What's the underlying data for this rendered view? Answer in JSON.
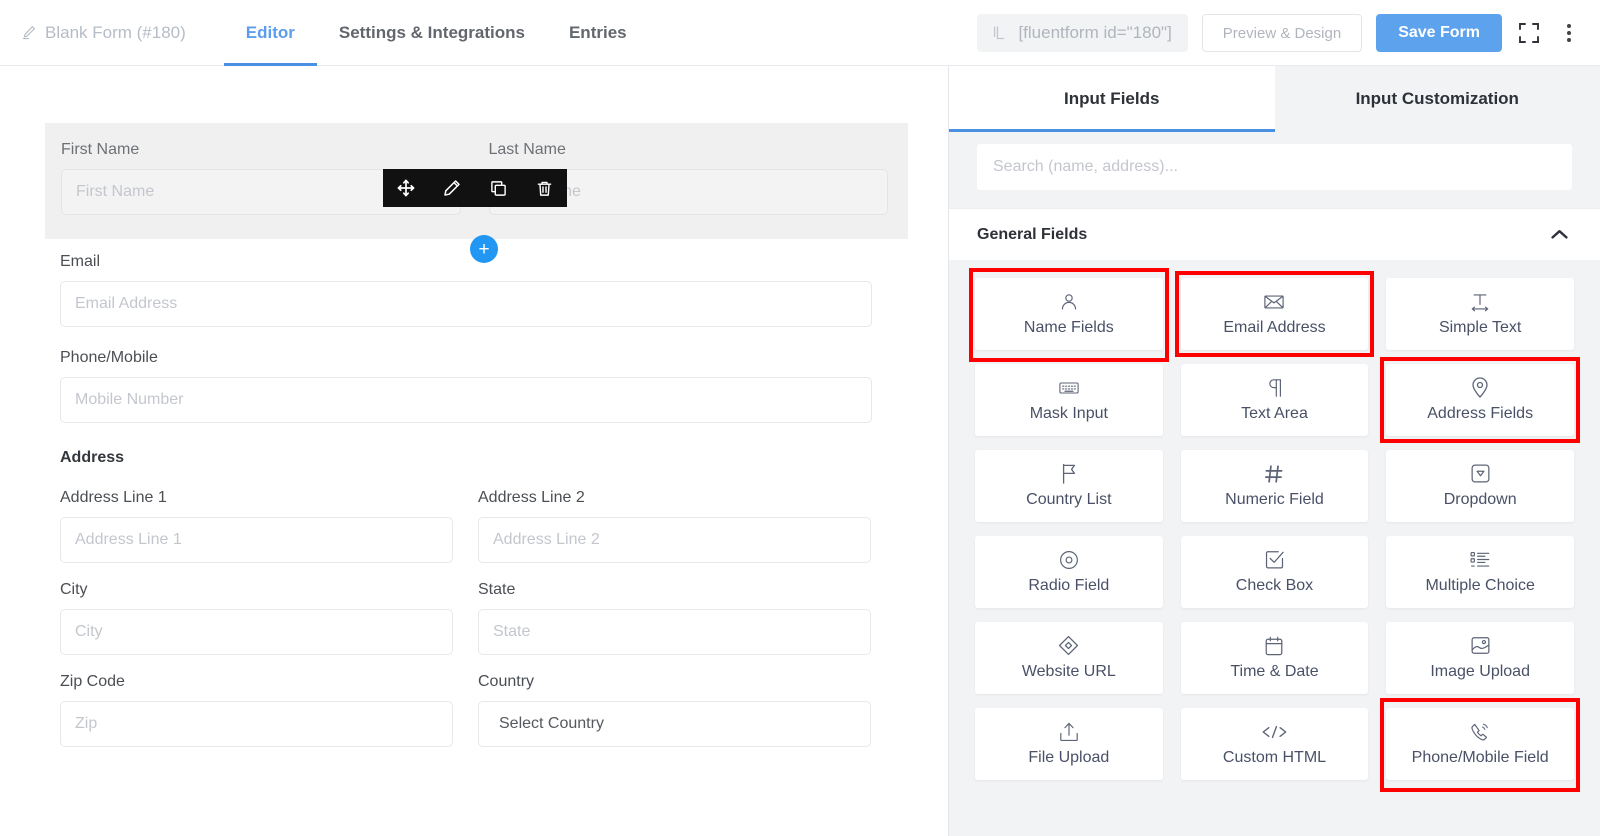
{
  "topbar": {
    "form_title": "Blank Form (#180)",
    "pencil_icon": "pencil-icon",
    "tabs": [
      {
        "label": "Editor",
        "active": true
      },
      {
        "label": "Settings & Integrations",
        "active": false
      },
      {
        "label": "Entries",
        "active": false
      }
    ],
    "shortcode": "[fluentform id=\"180\"]",
    "shortcode_icon": "shortcode-bracket-icon",
    "preview_label": "Preview & Design",
    "save_label": "Save Form",
    "fullscreen_icon": "fullscreen-icon",
    "more_icon": "more-vertical-icon",
    "accent_color": "#4a90e2",
    "save_button_color": "#5ca2ec"
  },
  "editor": {
    "element_toolbar": [
      {
        "name": "move-handle",
        "icon": "move-arrows-icon"
      },
      {
        "name": "edit-field",
        "icon": "pencil-icon"
      },
      {
        "name": "duplicate-field",
        "icon": "copy-icon"
      },
      {
        "name": "delete-field",
        "icon": "trash-icon"
      }
    ],
    "add_button_label": "+",
    "name_field": {
      "first": {
        "label": "First Name",
        "placeholder": "First Name"
      },
      "last": {
        "label": "Last Name",
        "placeholder": "Last Name"
      }
    },
    "email_field": {
      "label": "Email",
      "placeholder": "Email Address"
    },
    "phone_field": {
      "label": "Phone/Mobile",
      "placeholder": "Mobile Number"
    },
    "address_field": {
      "title": "Address",
      "rows": [
        {
          "label": "Address Line 1",
          "placeholder": "Address Line 1",
          "type": "text"
        },
        {
          "label": "Address Line 2",
          "placeholder": "Address Line 2",
          "type": "text"
        },
        {
          "label": "City",
          "placeholder": "City",
          "type": "text"
        },
        {
          "label": "State",
          "placeholder": "State",
          "type": "text"
        },
        {
          "label": "Zip Code",
          "placeholder": "Zip",
          "type": "text"
        },
        {
          "label": "Country",
          "placeholder": "Select Country",
          "type": "select"
        }
      ]
    }
  },
  "panel": {
    "tabs": [
      {
        "label": "Input Fields",
        "active": true
      },
      {
        "label": "Input Customization",
        "active": false
      }
    ],
    "search_placeholder": "Search (name, address)...",
    "group_title": "General Fields",
    "collapse_icon": "chevron-up-icon",
    "highlight_color": "#ff0000",
    "fields": [
      {
        "label": "Name Fields",
        "icon": "user-icon",
        "highlighted": true,
        "tall": true
      },
      {
        "label": "Email Address",
        "icon": "envelope-icon",
        "highlighted": true,
        "tall": false
      },
      {
        "label": "Simple Text",
        "icon": "text-width-icon",
        "highlighted": false,
        "tall": false
      },
      {
        "label": "Mask Input",
        "icon": "keyboard-icon",
        "highlighted": false,
        "tall": false
      },
      {
        "label": "Text Area",
        "icon": "paragraph-icon",
        "highlighted": false,
        "tall": false
      },
      {
        "label": "Address Fields",
        "icon": "map-pin-icon",
        "highlighted": true,
        "tall": false
      },
      {
        "label": "Country List",
        "icon": "flag-icon",
        "highlighted": false,
        "tall": false
      },
      {
        "label": "Numeric Field",
        "icon": "hash-icon",
        "highlighted": false,
        "tall": false
      },
      {
        "label": "Dropdown",
        "icon": "dropdown-icon",
        "highlighted": false,
        "tall": false
      },
      {
        "label": "Radio Field",
        "icon": "radio-icon",
        "highlighted": false,
        "tall": false
      },
      {
        "label": "Check Box",
        "icon": "checkbox-icon",
        "highlighted": false,
        "tall": false
      },
      {
        "label": "Multiple Choice",
        "icon": "list-icon",
        "highlighted": false,
        "tall": false
      },
      {
        "label": "Website URL",
        "icon": "link-icon",
        "highlighted": false,
        "tall": false
      },
      {
        "label": "Time & Date",
        "icon": "calendar-icon",
        "highlighted": false,
        "tall": false
      },
      {
        "label": "Image Upload",
        "icon": "image-icon",
        "highlighted": false,
        "tall": false
      },
      {
        "label": "File Upload",
        "icon": "upload-icon",
        "highlighted": false,
        "tall": false
      },
      {
        "label": "Custom HTML",
        "icon": "code-icon",
        "highlighted": false,
        "tall": false
      },
      {
        "label": "Phone/Mobile Field",
        "icon": "phone-icon",
        "highlighted": true,
        "tall": true
      }
    ]
  }
}
